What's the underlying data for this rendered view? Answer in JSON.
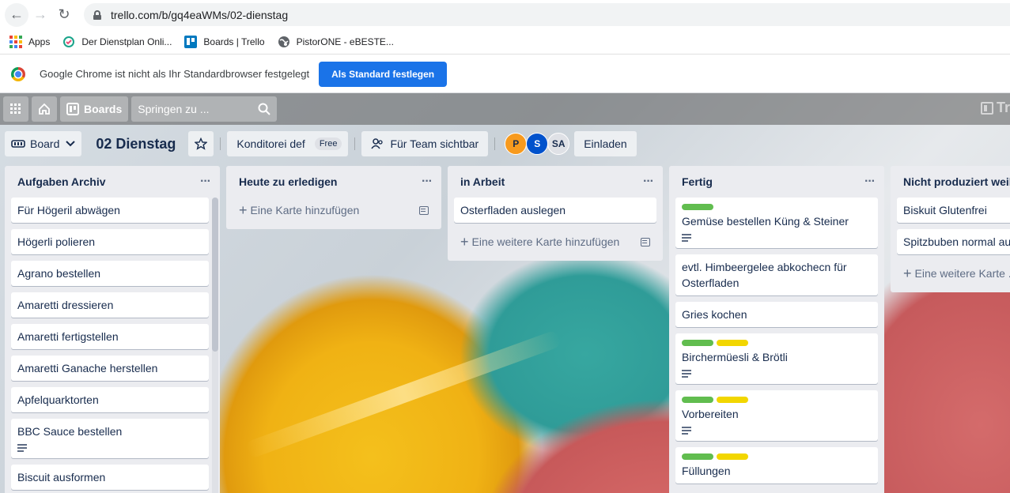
{
  "browser": {
    "url": "trello.com/b/gq4eaWMs/02-dienstag",
    "bookmarks": [
      {
        "label": "Apps"
      },
      {
        "label": "Der Dienstplan Onli..."
      },
      {
        "label": "Boards | Trello"
      },
      {
        "label": "PistorONE - eBESTE..."
      }
    ],
    "infobar": {
      "text": "Google Chrome ist nicht als Ihr Standardbrowser festgelegt",
      "button": "Als Standard festlegen"
    }
  },
  "trello_header": {
    "boards_label": "Boards",
    "search_placeholder": "Springen zu ...",
    "logo_text": "Tr"
  },
  "board": {
    "view_label": "Board",
    "title": "02 Dienstag",
    "team": "Konditorei def",
    "team_badge": "Free",
    "visibility": "Für Team sichtbar",
    "members": [
      {
        "initials": "P",
        "color": "#f79a1e",
        "text_color": "#172b4d"
      },
      {
        "initials": "S",
        "color": "#0052cc",
        "text_color": "#ffffff"
      },
      {
        "initials": "SA",
        "color": "#dfe1e6",
        "text_color": "#172b4d"
      }
    ],
    "invite_label": "Einladen"
  },
  "lists": [
    {
      "title": "Aufgaben Archiv",
      "cards": [
        {
          "text": "Für Högeril abwägen"
        },
        {
          "text": "Högerli polieren"
        },
        {
          "text": "Agrano bestellen"
        },
        {
          "text": "Amaretti dressieren"
        },
        {
          "text": "Amaretti fertigstellen"
        },
        {
          "text": "Amaretti Ganache herstellen"
        },
        {
          "text": "Apfelquarktorten"
        },
        {
          "text": "BBC Sauce bestellen",
          "desc": true
        },
        {
          "text": "Biscuit ausformen"
        }
      ]
    },
    {
      "title": "Heute zu erledigen",
      "cards": [],
      "add_label": "Eine Karte hinzufügen"
    },
    {
      "title": "in Arbeit",
      "cards": [
        {
          "text": "Osterfladen auslegen"
        }
      ],
      "add_label": "Eine weitere Karte hinzufügen"
    },
    {
      "title": "Fertig",
      "cards": [
        {
          "text": "Gemüse bestellen Küng & Steiner",
          "labels": [
            "#61bd4f"
          ],
          "desc": true
        },
        {
          "text": "evtl. Himbeergelee abkochecn für Osterfladen"
        },
        {
          "text": "Gries kochen"
        },
        {
          "text": "Birchermüesli & Brötli",
          "labels": [
            "#61bd4f",
            "#f2d600"
          ],
          "desc": true
        },
        {
          "text": "Vorbereiten",
          "labels": [
            "#61bd4f",
            "#f2d600"
          ],
          "desc": true
        },
        {
          "text": "Füllungen",
          "labels": [
            "#61bd4f",
            "#f2d600"
          ]
        }
      ]
    },
    {
      "title": "Nicht produziert weil...",
      "cards": [
        {
          "text": "Biskuit Glutenfrei"
        },
        {
          "text": "Spitzbuben normal au..."
        }
      ],
      "add_label": "Eine weitere Karte ..."
    }
  ]
}
